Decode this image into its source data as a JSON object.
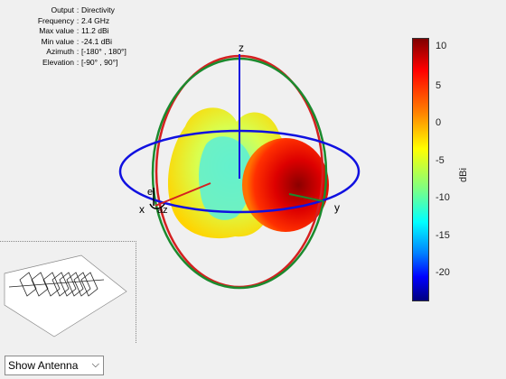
{
  "info": {
    "rows": [
      {
        "label": "Output",
        "value": "Directivity"
      },
      {
        "label": "Frequency",
        "value": "2.4 GHz"
      },
      {
        "label": "Max value",
        "value": "11.2 dBi"
      },
      {
        "label": "Min value",
        "value": "-24.1 dBi"
      },
      {
        "label": "Azimuth",
        "value": "[-180° , 180°]"
      },
      {
        "label": "Elevation",
        "value": "[-90° , 90°]"
      }
    ]
  },
  "axes": {
    "z": "z",
    "y": "y",
    "x": "x",
    "el": "el",
    "az": "az"
  },
  "colorbar": {
    "label": "dBi",
    "ticks": [
      "10",
      "5",
      "0",
      "-5",
      "-10",
      "-15",
      "-20"
    ]
  },
  "dropdown": {
    "selected": "Show Antenna"
  }
}
